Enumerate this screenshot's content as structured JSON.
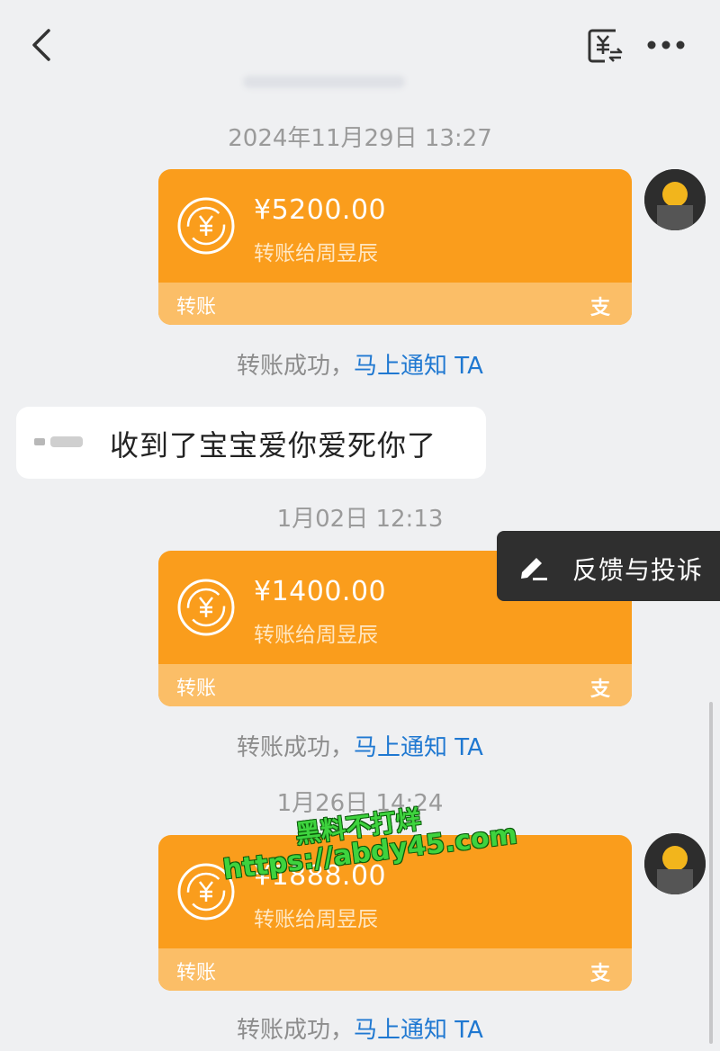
{
  "colors": {
    "card": "#fa9d1c",
    "card_footer": "#fbbe67",
    "link": "#1f78d1",
    "background": "#eff0f2"
  },
  "header": {
    "back_icon": "chevron-left-icon",
    "transfer_icon": "yuan-transfer-icon",
    "more_icon": "more-horizontal-icon"
  },
  "messages": [
    {
      "timestamp": "2024年11月29日 13:27",
      "amount": "¥5200.00",
      "desc": "转账给周昱辰",
      "label": "转账",
      "alipay": "支",
      "status": "转账成功，",
      "notify": "马上通知 TA"
    },
    {
      "timestamp": "1月02日 12:13",
      "amount": "¥1400.00",
      "desc": "转账给周昱辰",
      "label": "转账",
      "alipay": "支",
      "status": "转账成功，",
      "notify": "马上通知 TA"
    },
    {
      "timestamp": "1月26日 14:24",
      "amount": "¥1888.00",
      "desc": "转账给周昱辰",
      "label": "转账",
      "alipay": "支",
      "status": "转账成功，",
      "notify": "马上通知 TA"
    }
  ],
  "reply": {
    "text": "收到了宝宝爱你爱死你了"
  },
  "feedback": {
    "label": "反馈与投诉",
    "icon": "edit-pencil-icon"
  },
  "watermark": {
    "line1": "黑料不打烊",
    "line2": "https://abdy45.com"
  }
}
